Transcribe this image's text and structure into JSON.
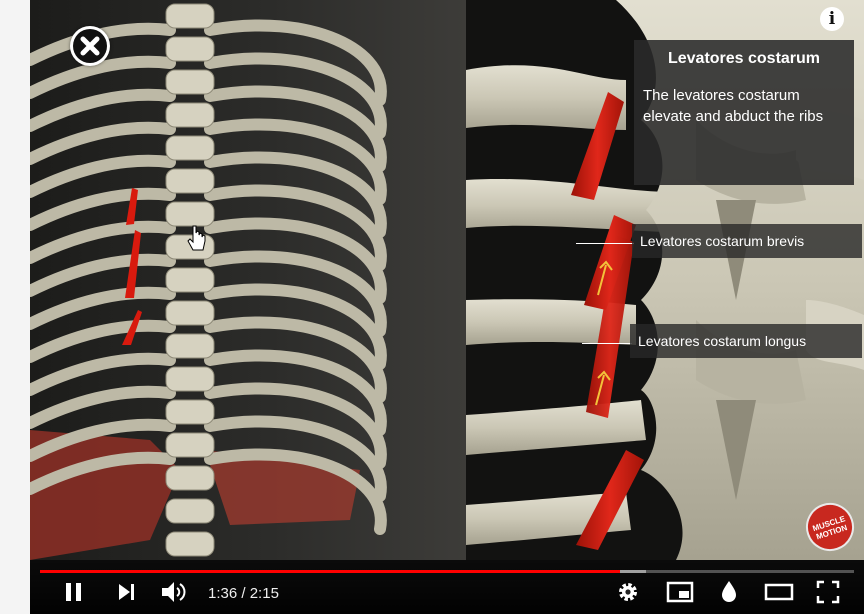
{
  "player": {
    "info_icon_label": "i",
    "time_current": "1:36",
    "time_separator": " / ",
    "time_total": "2:15",
    "progress_fraction": 0.713,
    "buffer_fraction": 0.745,
    "accent_color": "#ff0000",
    "controls": [
      {
        "name": "play-pause",
        "icon": "pause-icon"
      },
      {
        "name": "next",
        "icon": "skip-next-icon"
      },
      {
        "name": "volume",
        "icon": "volume-icon"
      },
      {
        "name": "settings",
        "icon": "gear-icon"
      },
      {
        "name": "miniplayer",
        "icon": "miniplayer-icon"
      },
      {
        "name": "ambient",
        "icon": "droplet-icon"
      },
      {
        "name": "theater",
        "icon": "theater-icon"
      },
      {
        "name": "fullscreen",
        "icon": "fullscreen-icon"
      }
    ]
  },
  "overlay": {
    "title": "Levatores costarum",
    "description": "The levatores costarum elevate and abduct the ribs",
    "labels": {
      "brevis": "Levatores costarum brevis",
      "longus": "Levatores costarum longus"
    },
    "logo_line1": "MUSCLE",
    "logo_line2": "MOTION"
  },
  "colors": {
    "bone": "#c9c5b4",
    "muscle": "#d11d10",
    "panel": "#2a2a2a"
  }
}
